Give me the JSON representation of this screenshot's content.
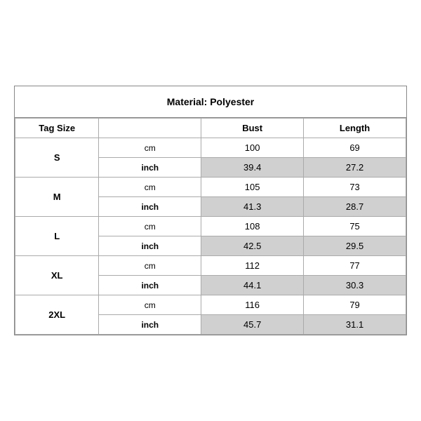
{
  "title": "Material: Polyester",
  "headers": {
    "tag_size": "Tag Size",
    "col2": "",
    "bust": "Bust",
    "length": "Length"
  },
  "rows": [
    {
      "size": "S",
      "cm": {
        "bust": "100",
        "length": "69"
      },
      "inch": {
        "bust": "39.4",
        "length": "27.2"
      }
    },
    {
      "size": "M",
      "cm": {
        "bust": "105",
        "length": "73"
      },
      "inch": {
        "bust": "41.3",
        "length": "28.7"
      }
    },
    {
      "size": "L",
      "cm": {
        "bust": "108",
        "length": "75"
      },
      "inch": {
        "bust": "42.5",
        "length": "29.5"
      }
    },
    {
      "size": "XL",
      "cm": {
        "bust": "112",
        "length": "77"
      },
      "inch": {
        "bust": "44.1",
        "length": "30.3"
      }
    },
    {
      "size": "2XL",
      "cm": {
        "bust": "116",
        "length": "79"
      },
      "inch": {
        "bust": "45.7",
        "length": "31.1"
      }
    }
  ],
  "units": {
    "cm": "cm",
    "inch": "inch"
  }
}
